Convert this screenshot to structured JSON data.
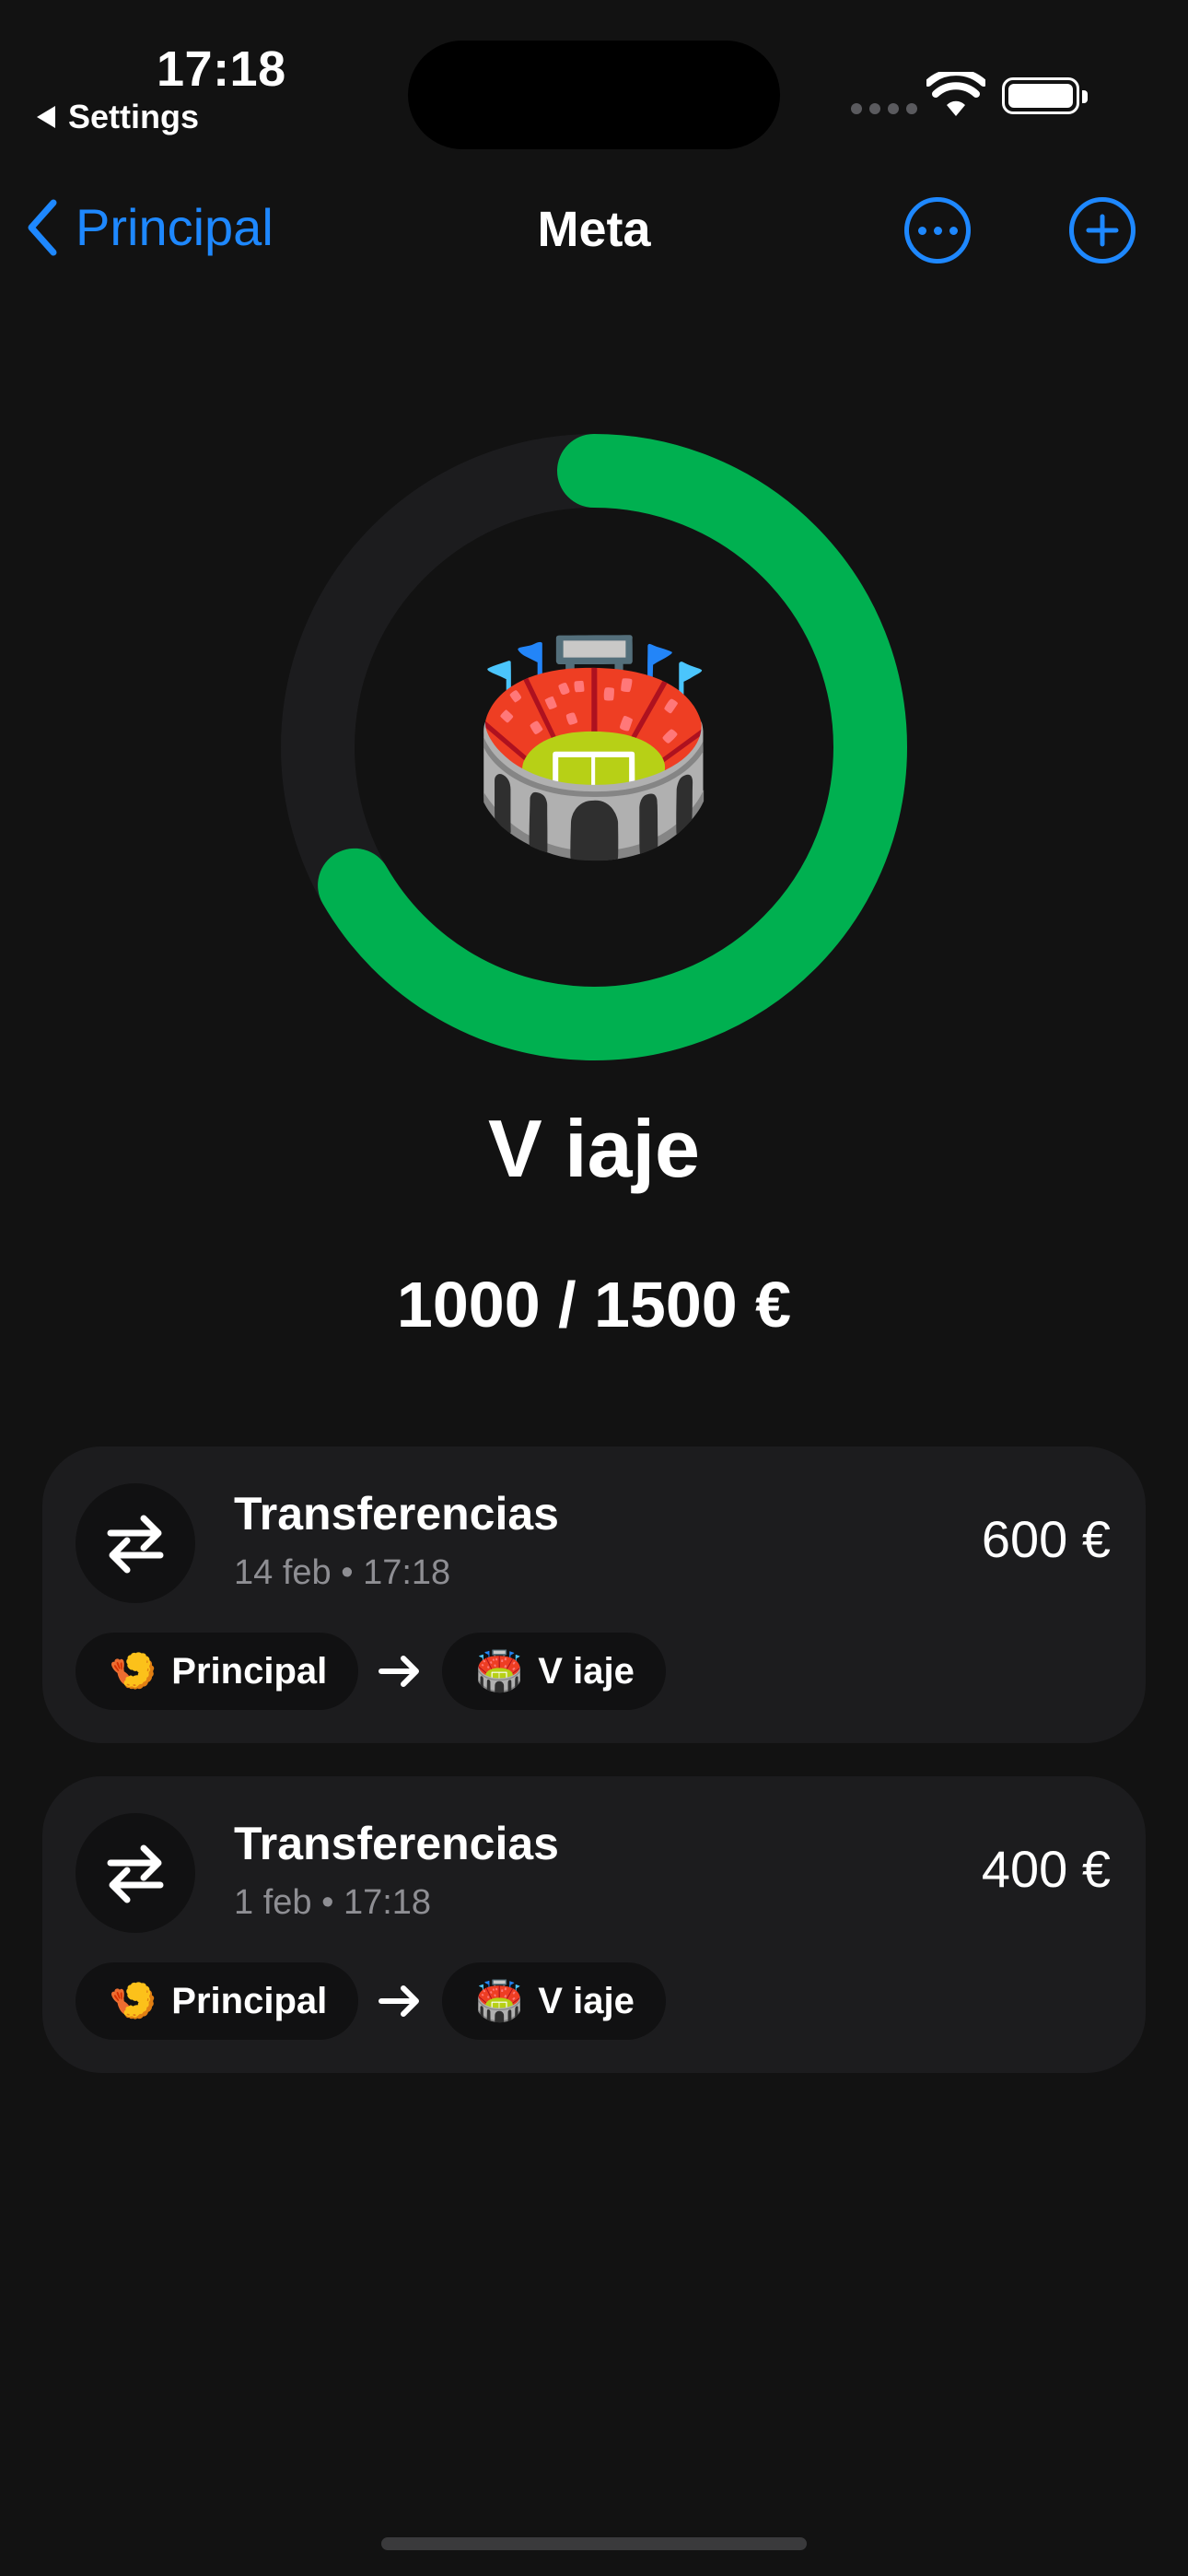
{
  "status_bar": {
    "time": "17:18",
    "back_label": "Settings"
  },
  "nav": {
    "back_label": "Principal",
    "title": "Meta"
  },
  "goal": {
    "emoji": "🏟️",
    "name": "V iaje",
    "amount_text": "1000 / 1500 €",
    "saved": 1000,
    "target": 1500,
    "progress_fraction": 0.6667,
    "ring_color": "#00b050",
    "track_color": "#1c1c1e"
  },
  "transactions": [
    {
      "title": "Transferencias",
      "date": "14 feb",
      "time": "17:18",
      "amount": "600 €",
      "from": {
        "emoji": "🍤",
        "label": "Principal"
      },
      "to": {
        "emoji": "🏟️",
        "label": "V iaje"
      }
    },
    {
      "title": "Transferencias",
      "date": "1 feb",
      "time": "17:18",
      "amount": "400 €",
      "from": {
        "emoji": "🍤",
        "label": "Principal"
      },
      "to": {
        "emoji": "🏟️",
        "label": "V iaje"
      }
    }
  ],
  "colors": {
    "accent": "#1e88ff",
    "background": "#121212",
    "card": "#1c1c1e"
  }
}
